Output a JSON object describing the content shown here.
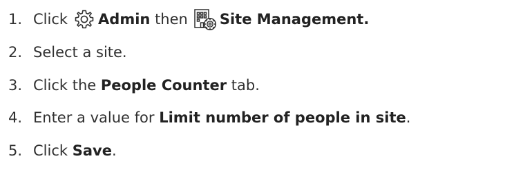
{
  "steps": [
    {
      "number": "1.",
      "click": "Click",
      "admin_icon": "gear-icon",
      "admin": "Admin",
      "then": "then",
      "site_icon": "building-gear-icon",
      "site_management": "Site Management."
    },
    {
      "number": "2.",
      "text": "Select a site."
    },
    {
      "number": "3.",
      "pre": "Click the",
      "bold": "People Counter",
      "post": "tab."
    },
    {
      "number": "4.",
      "pre": "Enter a value for",
      "bold": "Limit number of people in site",
      "post": "."
    },
    {
      "number": "5.",
      "pre": "Click",
      "bold": "Save",
      "post": "."
    }
  ]
}
